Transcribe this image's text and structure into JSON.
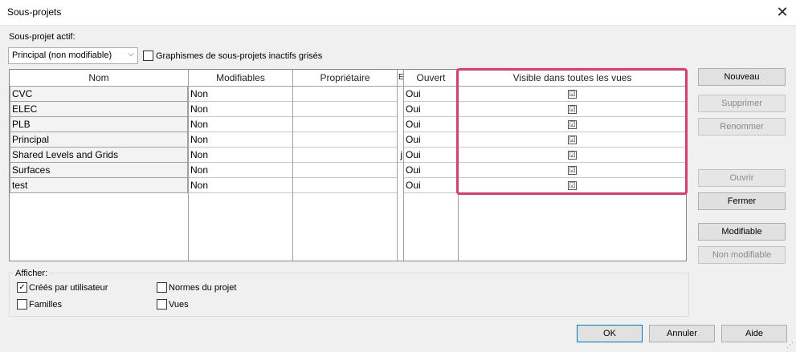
{
  "window": {
    "title": "Sous-projets"
  },
  "active": {
    "label": "Sous-projet actif:",
    "selected": "Principal (non modifiable)",
    "gray_inactive": "Graphismes de sous-projets inactifs grisés"
  },
  "table": {
    "headers": {
      "name": "Nom",
      "editable": "Modifiables",
      "owner": "Propriétaire",
      "borrowers": "E",
      "open": "Ouvert",
      "visible": "Visible dans toutes les vues"
    },
    "rows": [
      {
        "name": "CVC",
        "editable": "Non",
        "owner": "",
        "borrowers": "",
        "open": "Oui",
        "visible": "☑"
      },
      {
        "name": "ELEC",
        "editable": "Non",
        "owner": "",
        "borrowers": "",
        "open": "Oui",
        "visible": "☑"
      },
      {
        "name": "PLB",
        "editable": "Non",
        "owner": "",
        "borrowers": "",
        "open": "Oui",
        "visible": "☑"
      },
      {
        "name": "Principal",
        "editable": "Non",
        "owner": "",
        "borrowers": "",
        "open": "Oui",
        "visible": "☑"
      },
      {
        "name": "Shared Levels and Grids",
        "editable": "Non",
        "owner": "",
        "borrowers": "j",
        "open": "Oui",
        "visible": "☑"
      },
      {
        "name": "Surfaces",
        "editable": "Non",
        "owner": "",
        "borrowers": "",
        "open": "Oui",
        "visible": "☑"
      },
      {
        "name": "test",
        "editable": "Non",
        "owner": "",
        "borrowers": "",
        "open": "Oui",
        "visible": "☑"
      }
    ]
  },
  "buttons": {
    "new": "Nouveau",
    "delete": "Supprimer",
    "rename": "Renommer",
    "open": "Ouvrir",
    "close": "Fermer",
    "editable": "Modifiable",
    "non_editable": "Non modifiable",
    "ok": "OK",
    "cancel": "Annuler",
    "help": "Aide"
  },
  "show": {
    "label": "Afficher:",
    "user_created": "Créés par utilisateur",
    "user_created_checked": "✓",
    "families": "Familles",
    "project_standards": "Normes du projet",
    "views": "Vues"
  },
  "highlight_color": "#e8376b"
}
